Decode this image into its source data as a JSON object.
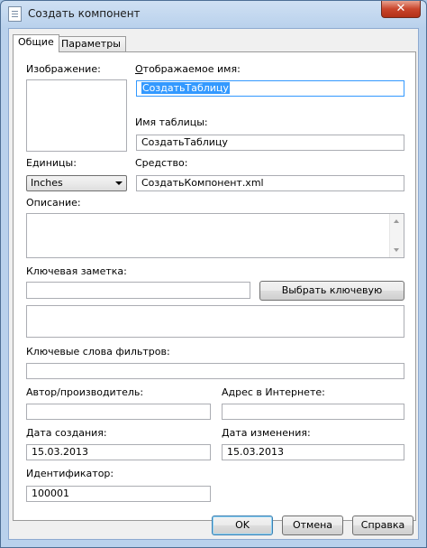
{
  "window": {
    "title": "Создать компонент",
    "close_label": "✕"
  },
  "tabs": [
    {
      "label": "Общие"
    },
    {
      "label": "Параметры"
    }
  ],
  "form": {
    "image_label": "Изображение:",
    "display_name_label": "Отображаемое имя:",
    "display_name_value": "СоздатьТаблицу",
    "table_name_label": "Имя таблицы:",
    "table_name_value": "СоздатьТаблицу",
    "units_label": "Единицы:",
    "units_value": "Inches",
    "tool_label": "Средство:",
    "tool_value": "СоздатьКомпонент.xml",
    "description_label": "Описание:",
    "description_value": "",
    "key_note_label": "Ключевая заметка:",
    "key_note_value": "",
    "key_note_button": "Выбрать ключевую заметку...",
    "key_note_text": "",
    "filter_keywords_label": "Ключевые слова фильтров:",
    "filter_keywords_value": "",
    "author_label": "Автор/производитель:",
    "author_value": "",
    "url_label": "Адрес в Интернете:",
    "url_value": "",
    "created_label": "Дата создания:",
    "created_value": "15.03.2013",
    "modified_label": "Дата изменения:",
    "modified_value": "15.03.2013",
    "id_label": "Идентификатор:",
    "id_value": "100001"
  },
  "buttons": {
    "ok": "OK",
    "cancel": "Отмена",
    "help": "Справка"
  },
  "colors": {
    "selection": "#3399ff",
    "titlebar": "#b9d1ec",
    "close": "#c9452b"
  }
}
